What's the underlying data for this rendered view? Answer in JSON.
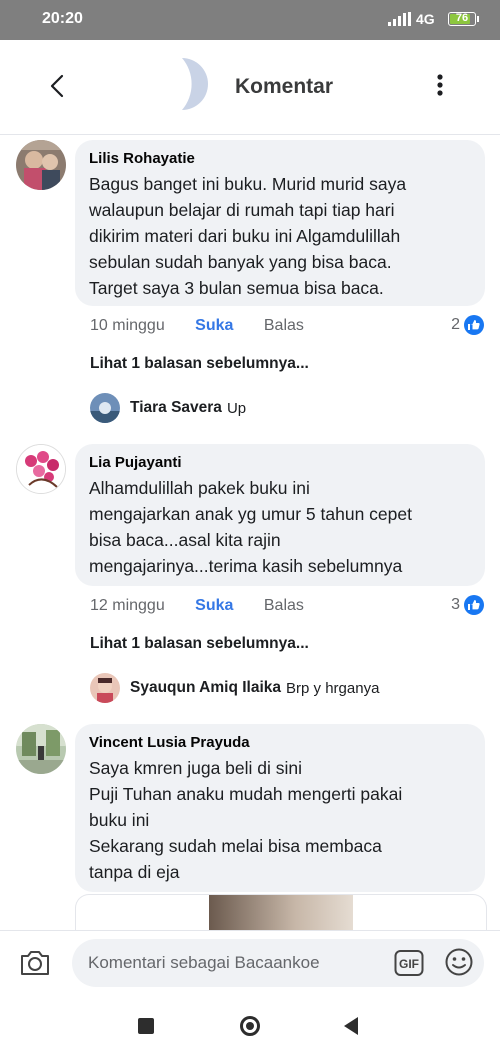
{
  "status_bar": {
    "time": "20:20",
    "network": "4G",
    "battery": "76"
  },
  "header": {
    "title": "Komentar"
  },
  "comments": [
    {
      "author": "Lilis Rohayatie",
      "text": "Bagus banget ini buku. Murid murid saya\nwalaupun belajar di rumah tapi tiap hari\ndikirim materi dari buku ini Algamdulillah\nsebulan sudah banyak yang bisa baca.\nTarget saya 3 bulan semua bisa baca.",
      "time": "10 minggu",
      "like_label": "Suka",
      "reply_label": "Balas",
      "reaction_count": "2",
      "previous_replies": "Lihat 1 balasan sebelumnya...",
      "reply": {
        "author": "Tiara Savera",
        "text": "Up"
      }
    },
    {
      "author": "Lia Pujayanti",
      "text": "Alhamdulillah pakek buku ini\nmengajarkan anak yg umur 5 tahun cepet\nbisa baca...asal kita rajin\nmengajarinya...terima kasih sebelumnya",
      "time": "12 minggu",
      "like_label": "Suka",
      "reply_label": "Balas",
      "reaction_count": "3",
      "previous_replies": "Lihat 1 balasan sebelumnya...",
      "reply": {
        "author": "Syauqun Amiq Ilaika",
        "text": "Brp y hrganya"
      }
    },
    {
      "author": "Vincent Lusia Prayuda",
      "text": "Saya kmren juga beli di sini\nPuji Tuhan anaku mudah mengerti pakai\nbuku ini\nSekarang sudah melai bisa membaca\ntanpa di eja"
    }
  ],
  "composer": {
    "placeholder": "Komentari sebagai Bacaankoe",
    "gif_label": "GIF"
  },
  "colors": {
    "accent": "#1877f2",
    "bubble": "#f0f2f5",
    "muted": "#65676b"
  }
}
